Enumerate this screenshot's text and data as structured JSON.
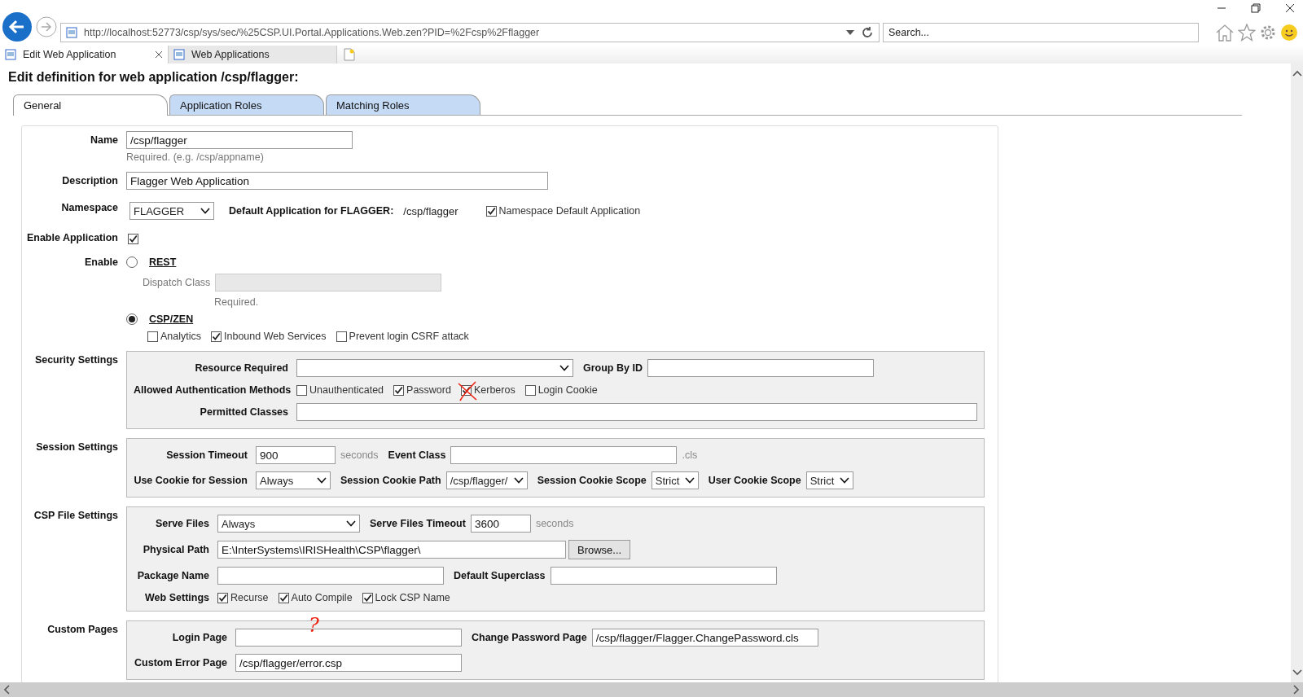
{
  "browser": {
    "address": "http://localhost:52773/csp/sys/sec/%25CSP.UI.Portal.Applications.Web.zen?PID=%2Fcsp%2Fflagger",
    "search_placeholder": "Search...",
    "tabs": [
      {
        "label": "Edit Web Application",
        "selected": true
      },
      {
        "label": "Web Applications",
        "selected": false
      }
    ]
  },
  "page": {
    "title": "Edit definition for web application /csp/flagger:",
    "tabs": [
      {
        "label": "General",
        "selected": true
      },
      {
        "label": "Application Roles",
        "selected": false
      },
      {
        "label": "Matching Roles",
        "selected": false
      }
    ]
  },
  "form": {
    "name": {
      "label": "Name",
      "value": "/csp/flagger",
      "hint": "Required. (e.g. /csp/appname)"
    },
    "description": {
      "label": "Description",
      "value": "Flagger Web Application"
    },
    "namespace": {
      "label": "Namespace",
      "value": "FLAGGER",
      "default_label": "Default Application for FLAGGER:",
      "default_value": "/csp/flagger",
      "checkbox": {
        "label": "Namespace Default Application",
        "checked": true
      }
    },
    "enable_application": {
      "label": "Enable Application",
      "checked": true
    },
    "enable": {
      "label": "Enable",
      "options": [
        {
          "label": "REST",
          "selected": false,
          "dispatch_label": "Dispatch Class",
          "dispatch_hint": "Required."
        },
        {
          "label": "CSP/ZEN",
          "selected": true,
          "checkboxes": [
            {
              "label": "Analytics",
              "checked": false
            },
            {
              "label": "Inbound Web Services",
              "checked": true
            },
            {
              "label": "Prevent login CSRF attack",
              "checked": false
            }
          ]
        }
      ]
    }
  },
  "sections": [
    {
      "title": "Security Settings",
      "rows": [
        {
          "items": [
            {
              "kind": "label",
              "text": "Resource Required"
            },
            {
              "kind": "select"
            },
            {
              "kind": "label",
              "text": "Group By ID"
            },
            {
              "kind": "input"
            }
          ]
        },
        {
          "items": [
            {
              "kind": "label",
              "text": "Allowed Authentication Methods"
            },
            {
              "kind": "checks",
              "items": [
                {
                  "label": "Unauthenticated",
                  "checked": false
                },
                {
                  "label": "Password",
                  "checked": true
                },
                {
                  "label": "Kerberos",
                  "checked": true,
                  "annotation": {
                    "kind": "cross"
                  }
                },
                {
                  "label": "Login Cookie",
                  "checked": false
                }
              ]
            }
          ]
        },
        {
          "items": [
            {
              "kind": "label",
              "text": "Permitted Classes"
            },
            {
              "kind": "input"
            }
          ]
        }
      ]
    },
    {
      "title": "Session Settings",
      "rows": [
        {
          "items": [
            {
              "kind": "label",
              "text": "Session Timeout"
            },
            {
              "kind": "input",
              "value": "900"
            },
            {
              "kind": "unit",
              "text": "seconds"
            },
            {
              "kind": "label",
              "text": "Event Class"
            },
            {
              "kind": "input"
            },
            {
              "kind": "unit",
              "text": ".cls"
            }
          ]
        },
        {
          "items": [
            {
              "kind": "label",
              "text": "Use Cookie for Session"
            },
            {
              "kind": "select",
              "value": "Always"
            },
            {
              "kind": "label",
              "text": "Session Cookie Path"
            },
            {
              "kind": "select",
              "value": "/csp/flagger/"
            },
            {
              "kind": "label",
              "text": "Session Cookie Scope"
            },
            {
              "kind": "select",
              "value": "Strict"
            },
            {
              "kind": "label",
              "text": "User Cookie Scope"
            },
            {
              "kind": "select",
              "value": "Strict"
            }
          ]
        }
      ]
    },
    {
      "title": "CSP File Settings",
      "rows": [
        {
          "items": [
            {
              "kind": "label",
              "text": "Serve Files"
            },
            {
              "kind": "select",
              "value": "Always"
            },
            {
              "kind": "label",
              "text": "Serve Files Timeout"
            },
            {
              "kind": "input",
              "value": "3600"
            },
            {
              "kind": "unit",
              "text": "seconds"
            }
          ]
        },
        {
          "items": [
            {
              "kind": "label",
              "text": "Physical Path"
            },
            {
              "kind": "input",
              "value": "E:\\InterSystems\\IRISHealth\\CSP\\flagger\\"
            },
            {
              "kind": "button",
              "text": "Browse..."
            }
          ]
        },
        {
          "items": [
            {
              "kind": "label",
              "text": "Package Name"
            },
            {
              "kind": "input"
            },
            {
              "kind": "label",
              "text": "Default Superclass"
            },
            {
              "kind": "input"
            }
          ]
        },
        {
          "items": [
            {
              "kind": "label",
              "text": "Web Settings"
            },
            {
              "kind": "checks",
              "items": [
                {
                  "label": "Recurse",
                  "checked": true
                },
                {
                  "label": "Auto Compile",
                  "checked": true
                },
                {
                  "label": "Lock CSP Name",
                  "checked": true
                }
              ]
            }
          ]
        }
      ]
    },
    {
      "title": "Custom Pages",
      "rows": [
        {
          "items": [
            {
              "kind": "label",
              "text": "Login Page"
            },
            {
              "kind": "input",
              "annotation": {
                "kind": "note",
                "text": "?"
              }
            },
            {
              "kind": "label",
              "text": "Change Password Page"
            },
            {
              "kind": "input",
              "value": "/csp/flagger/Flagger.ChangePassword.cls"
            }
          ]
        },
        {
          "items": [
            {
              "kind": "label",
              "text": "Custom Error Page"
            },
            {
              "kind": "input",
              "value": "/csp/flagger/error.csp"
            }
          ]
        }
      ]
    }
  ]
}
